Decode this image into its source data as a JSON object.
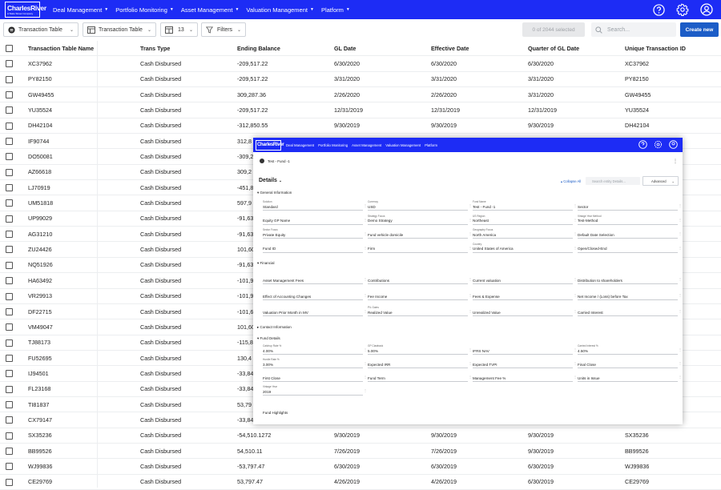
{
  "app": {
    "logo_text": "CharlesRiver",
    "logo_sub": "A State Street Company"
  },
  "nav": [
    {
      "label": "Deal Management"
    },
    {
      "label": "Portfolio Monitoring"
    },
    {
      "label": "Asset Management"
    },
    {
      "label": "Valuation Management"
    },
    {
      "label": "Platform"
    }
  ],
  "header_icons": [
    "help-icon",
    "settings-gear-icon",
    "user-avatar-icon"
  ],
  "toolbar": {
    "view_select": "Transaction Table",
    "table_select": "Transaction Table",
    "columns_count": "13",
    "filters_label": "Filters",
    "selected_status": "0 of 2044 selected",
    "search_placeholder": "Search...",
    "create_label": "Create new"
  },
  "table": {
    "columns": [
      "Transaction Table Name",
      "Trans Type",
      "Ending Balance",
      "GL Date",
      "Effective Date",
      "Quarter of GL Date",
      "Unique Transaction ID"
    ],
    "rows": [
      [
        "XC37962",
        "Cash Disbursed",
        "-209,517.22",
        "6/30/2020",
        "6/30/2020",
        "6/30/2020",
        "XC37962"
      ],
      [
        "PY82150",
        "Cash Disbursed",
        "-209,517.22",
        "3/31/2020",
        "3/31/2020",
        "3/31/2020",
        "PY82150"
      ],
      [
        "GW49455",
        "Cash Disbursed",
        "309,287.36",
        "2/26/2020",
        "2/26/2020",
        "3/31/2020",
        "GW49455"
      ],
      [
        "YU35524",
        "Cash Disbursed",
        "-209,517.22",
        "12/31/2019",
        "12/31/2019",
        "12/31/2019",
        "YU35524"
      ],
      [
        "DH42104",
        "Cash Disbursed",
        "-312,850.55",
        "9/30/2019",
        "9/30/2019",
        "9/30/2019",
        "DH42104"
      ],
      [
        "IF90744",
        "Cash Disbursed",
        "312,8",
        "",
        "",
        "",
        ""
      ],
      [
        "DO50081",
        "Cash Disbursed",
        "-309,2",
        "",
        "",
        "",
        ""
      ],
      [
        "AZ66618",
        "Cash Disbursed",
        "309,2",
        "",
        "",
        "",
        ""
      ],
      [
        "LJ70919",
        "Cash Disbursed",
        "-451,8",
        "",
        "",
        "",
        ""
      ],
      [
        "UM51818",
        "Cash Disbursed",
        "597,9",
        "",
        "",
        "",
        ""
      ],
      [
        "UP99029",
        "Cash Disbursed",
        "-91,63",
        "",
        "",
        "",
        ""
      ],
      [
        "AG31210",
        "Cash Disbursed",
        "-91,63",
        "",
        "",
        "",
        ""
      ],
      [
        "ZU24426",
        "Cash Disbursed",
        "101,60",
        "",
        "",
        "",
        ""
      ],
      [
        "NQ51926",
        "Cash Disbursed",
        "-91,63",
        "",
        "",
        "",
        ""
      ],
      [
        "HA63492",
        "Cash Disbursed",
        "-101,9",
        "",
        "",
        "",
        ""
      ],
      [
        "VR29913",
        "Cash Disbursed",
        "-101,9",
        "",
        "",
        "",
        ""
      ],
      [
        "DF22715",
        "Cash Disbursed",
        "-101,6",
        "",
        "",
        "",
        ""
      ],
      [
        "VM49047",
        "Cash Disbursed",
        "101,60",
        "",
        "",
        "",
        ""
      ],
      [
        "TJ88173",
        "Cash Disbursed",
        "-115,8",
        "",
        "",
        "",
        ""
      ],
      [
        "FU52695",
        "Cash Disbursed",
        "130,4",
        "",
        "",
        "",
        ""
      ],
      [
        "IJ94501",
        "Cash Disbursed",
        "-33,84",
        "",
        "",
        "",
        ""
      ],
      [
        "FL23168",
        "Cash Disbursed",
        "-33,84",
        "",
        "",
        "",
        ""
      ],
      [
        "TI81837",
        "Cash Disbursed",
        "53,79",
        "",
        "",
        "",
        ""
      ],
      [
        "CX79147",
        "Cash Disbursed",
        "-33,84",
        "",
        "",
        "",
        ""
      ],
      [
        "SX35236",
        "Cash Disbursed",
        "-54,510.1272",
        "9/30/2019",
        "9/30/2019",
        "9/30/2019",
        "SX35236"
      ],
      [
        "BB99526",
        "Cash Disbursed",
        "54,510.11",
        "7/26/2019",
        "7/26/2019",
        "9/30/2019",
        "BB99526"
      ],
      [
        "WJ99836",
        "Cash Disbursed",
        "-53,797.47",
        "6/30/2019",
        "6/30/2019",
        "6/30/2019",
        "WJ99836"
      ],
      [
        "CE29769",
        "Cash Disbursed",
        "53,797.47",
        "4/26/2019",
        "4/26/2019",
        "6/30/2019",
        "CE29769"
      ]
    ]
  },
  "popup": {
    "record_name": "Test - Fund -1",
    "details_label": "Details",
    "collapse_label": "Collapse All",
    "search_placeholder": "Search entity Details...",
    "advanced_label": "Advanced",
    "sections": {
      "general": "General Information",
      "financial": "Financial",
      "contact": "Contact Information",
      "fund_details": "Fund Details",
      "fund_highlights": "Fund Highlights"
    },
    "general_fields": [
      {
        "label": "Solution",
        "value": "Standard"
      },
      {
        "label": "Currency",
        "value": "USD"
      },
      {
        "label": "Fund Name",
        "value": "Test - Fund -1"
      },
      {
        "label": "",
        "value": "Sector"
      },
      {
        "label": "",
        "value": "Equity GP Name"
      },
      {
        "label": "Strategy Focus",
        "value": "Demo Strategy"
      },
      {
        "label": "US Region",
        "value": "Northeast"
      },
      {
        "label": "Vintage Year Method",
        "value": "Test-Method"
      },
      {
        "label": "Sector Focus",
        "value": "Private Equity"
      },
      {
        "label": "",
        "value": "Fund vehicle domicile"
      },
      {
        "label": "Geography Focus",
        "value": "North America"
      },
      {
        "label": "",
        "value": "Default Date Selection"
      },
      {
        "label": "",
        "value": "Fund ID"
      },
      {
        "label": "",
        "value": "Firm"
      },
      {
        "label": "Country",
        "value": "United States of America"
      },
      {
        "label": "",
        "value": "Open/Closed-End"
      }
    ],
    "financial_fields": [
      {
        "label": "",
        "value": "Asset Management Fees"
      },
      {
        "label": "",
        "value": "Contributions"
      },
      {
        "label": "",
        "value": "Current valuation"
      },
      {
        "label": "",
        "value": "Distribution to shareholders"
      },
      {
        "label": "",
        "value": "Effect of Accounting Changes"
      },
      {
        "label": "",
        "value": "Fee Income"
      },
      {
        "label": "",
        "value": "Fees & Expense"
      },
      {
        "label": "",
        "value": "Net Income / (Loss) before Tax"
      },
      {
        "label": "",
        "value": "Valuation Prior Month in MV"
      },
      {
        "label": "P/L Gains",
        "value": "Realized Value"
      },
      {
        "label": "",
        "value": "Unrealized Value"
      },
      {
        "label": "",
        "value": "Carried Interest"
      }
    ],
    "fund_fields": [
      {
        "label": "Catchup Rate %",
        "value": "4.00%"
      },
      {
        "label": "GP Clawback",
        "value": "5.00%"
      },
      {
        "label": "",
        "value": "IFRS NAV"
      },
      {
        "label": "Carried Interest %",
        "value": "4.50%"
      },
      {
        "label": "Hurdle Rate %",
        "value": "3.00%"
      },
      {
        "label": "",
        "value": "Expected IRR"
      },
      {
        "label": "",
        "value": "Expected TVPI"
      },
      {
        "label": "",
        "value": "Final Close"
      },
      {
        "label": "",
        "value": "First Close"
      },
      {
        "label": "",
        "value": "Fund Term"
      },
      {
        "label": "",
        "value": "Management Fee %"
      },
      {
        "label": "",
        "value": "Units in Issue"
      },
      {
        "label": "Vintage Year",
        "value": "2019"
      }
    ]
  },
  "colors": {
    "brand_blue": "#1d2cf5",
    "button_blue": "#1c5dc7"
  }
}
